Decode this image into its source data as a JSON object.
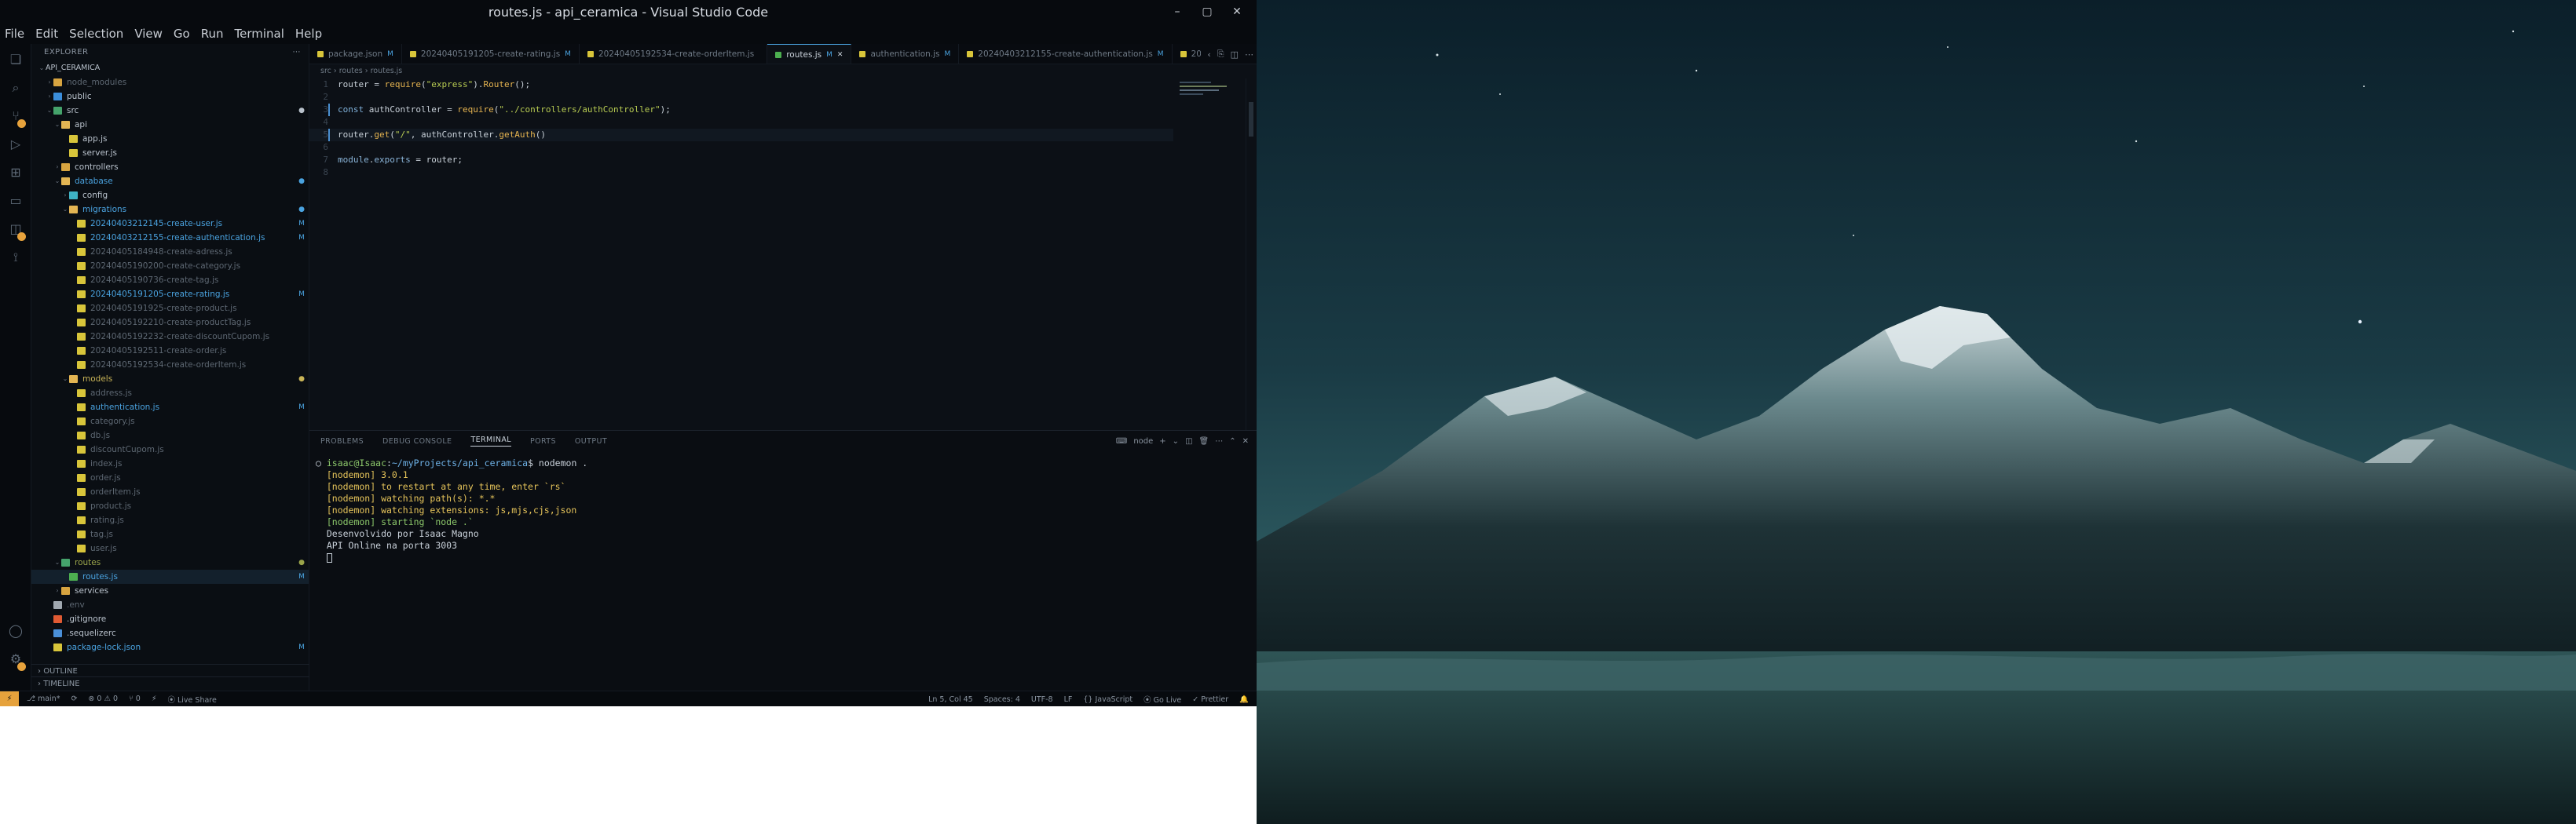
{
  "window": {
    "title": "routes.js - api_ceramica - Visual Studio Code",
    "controls": [
      "–",
      "▢",
      "✕"
    ]
  },
  "menu": [
    "File",
    "Edit",
    "Selection",
    "View",
    "Go",
    "Run",
    "Terminal",
    "Help"
  ],
  "explorer": {
    "header": "EXPLORER",
    "root": "API_CERAMICA",
    "tree": [
      {
        "label": "node_modules",
        "depth": 1,
        "icon": "folder",
        "color": "gray",
        "chev": "›",
        "stat": ""
      },
      {
        "label": "public",
        "depth": 1,
        "icon": "folder-blue",
        "color": "white",
        "chev": "›",
        "stat": ""
      },
      {
        "label": "src",
        "depth": 1,
        "icon": "folder-green",
        "color": "white",
        "chev": "⌄",
        "stat": "●"
      },
      {
        "label": "api",
        "depth": 2,
        "icon": "folder-open",
        "color": "white",
        "chev": "⌄",
        "stat": ""
      },
      {
        "label": "app.js",
        "depth": 3,
        "icon": "js",
        "color": "white",
        "chev": "",
        "stat": ""
      },
      {
        "label": "server.js",
        "depth": 3,
        "icon": "js",
        "color": "white",
        "chev": "",
        "stat": ""
      },
      {
        "label": "controllers",
        "depth": 2,
        "icon": "folder",
        "color": "white",
        "chev": "›",
        "stat": ""
      },
      {
        "label": "database",
        "depth": 2,
        "icon": "folder-open",
        "color": "mod",
        "chev": "⌄",
        "stat": "●"
      },
      {
        "label": "config",
        "depth": 3,
        "icon": "folder-cyan",
        "color": "white",
        "chev": "›",
        "stat": ""
      },
      {
        "label": "migrations",
        "depth": 3,
        "icon": "folder-open",
        "color": "mod",
        "chev": "⌄",
        "stat": "●"
      },
      {
        "label": "20240403212145-create-user.js",
        "depth": 4,
        "icon": "js",
        "color": "mod",
        "chev": "",
        "stat": "M"
      },
      {
        "label": "20240403212155-create-authentication.js",
        "depth": 4,
        "icon": "js",
        "color": "mod",
        "chev": "",
        "stat": "M"
      },
      {
        "label": "20240405184948-create-adress.js",
        "depth": 4,
        "icon": "js",
        "color": "gray",
        "chev": "",
        "stat": ""
      },
      {
        "label": "20240405190200-create-category.js",
        "depth": 4,
        "icon": "js",
        "color": "gray",
        "chev": "",
        "stat": ""
      },
      {
        "label": "20240405190736-create-tag.js",
        "depth": 4,
        "icon": "js",
        "color": "gray",
        "chev": "",
        "stat": ""
      },
      {
        "label": "20240405191205-create-rating.js",
        "depth": 4,
        "icon": "js",
        "color": "mod",
        "chev": "",
        "stat": "M"
      },
      {
        "label": "20240405191925-create-product.js",
        "depth": 4,
        "icon": "js",
        "color": "gray",
        "chev": "",
        "stat": ""
      },
      {
        "label": "20240405192210-create-productTag.js",
        "depth": 4,
        "icon": "js",
        "color": "gray",
        "chev": "",
        "stat": ""
      },
      {
        "label": "20240405192232-create-discountCupom.js",
        "depth": 4,
        "icon": "js",
        "color": "gray",
        "chev": "",
        "stat": ""
      },
      {
        "label": "20240405192511-create-order.js",
        "depth": 4,
        "icon": "js",
        "color": "gray",
        "chev": "",
        "stat": ""
      },
      {
        "label": "20240405192534-create-orderItem.js",
        "depth": 4,
        "icon": "js",
        "color": "gray",
        "chev": "",
        "stat": ""
      },
      {
        "label": "models",
        "depth": 3,
        "icon": "folder-open",
        "color": "yellow",
        "chev": "⌄",
        "stat": "●"
      },
      {
        "label": "address.js",
        "depth": 4,
        "icon": "js",
        "color": "gray",
        "chev": "",
        "stat": ""
      },
      {
        "label": "authentication.js",
        "depth": 4,
        "icon": "js",
        "color": "mod",
        "chev": "",
        "stat": "M"
      },
      {
        "label": "category.js",
        "depth": 4,
        "icon": "js",
        "color": "gray",
        "chev": "",
        "stat": ""
      },
      {
        "label": "db.js",
        "depth": 4,
        "icon": "js",
        "color": "gray",
        "chev": "",
        "stat": ""
      },
      {
        "label": "discountCupom.js",
        "depth": 4,
        "icon": "js",
        "color": "gray",
        "chev": "",
        "stat": ""
      },
      {
        "label": "index.js",
        "depth": 4,
        "icon": "js",
        "color": "gray",
        "chev": "",
        "stat": ""
      },
      {
        "label": "order.js",
        "depth": 4,
        "icon": "js",
        "color": "gray",
        "chev": "",
        "stat": ""
      },
      {
        "label": "orderItem.js",
        "depth": 4,
        "icon": "js",
        "color": "gray",
        "chev": "",
        "stat": ""
      },
      {
        "label": "product.js",
        "depth": 4,
        "icon": "js",
        "color": "gray",
        "chev": "",
        "stat": ""
      },
      {
        "label": "rating.js",
        "depth": 4,
        "icon": "js",
        "color": "gray",
        "chev": "",
        "stat": ""
      },
      {
        "label": "tag.js",
        "depth": 4,
        "icon": "js",
        "color": "gray",
        "chev": "",
        "stat": ""
      },
      {
        "label": "user.js",
        "depth": 4,
        "icon": "js",
        "color": "gray",
        "chev": "",
        "stat": ""
      },
      {
        "label": "routes",
        "depth": 2,
        "icon": "folder-green",
        "color": "olive",
        "chev": "⌄",
        "stat": "●"
      },
      {
        "label": "routes.js",
        "depth": 3,
        "icon": "route",
        "color": "mod",
        "chev": "",
        "stat": "M",
        "selected": true
      },
      {
        "label": "services",
        "depth": 2,
        "icon": "folder",
        "color": "white",
        "chev": "›",
        "stat": ""
      },
      {
        "label": ".env",
        "depth": 1,
        "icon": "env",
        "color": "gray",
        "chev": "",
        "stat": ""
      },
      {
        "label": ".gitignore",
        "depth": 1,
        "icon": "git",
        "color": "white",
        "chev": "",
        "stat": ""
      },
      {
        "label": ".sequelizerc",
        "depth": 1,
        "icon": "npm",
        "color": "white",
        "chev": "",
        "stat": ""
      },
      {
        "label": "package-lock.json",
        "depth": 1,
        "icon": "json",
        "color": "mod",
        "chev": "",
        "stat": "M"
      }
    ],
    "outline": "OUTLINE",
    "timeline": "TIMELINE"
  },
  "tabs": [
    {
      "label": "package.json",
      "mod": "M",
      "icon": "#d8c53a",
      "active": false
    },
    {
      "label": "20240405191205-create-rating.js",
      "mod": "M",
      "icon": "#d8c53a",
      "active": false
    },
    {
      "label": "20240405192534-create-orderItem.js",
      "mod": "",
      "icon": "#d8c53a",
      "active": false
    },
    {
      "label": "routes.js",
      "mod": "M",
      "icon": "#4caf50",
      "active": true
    },
    {
      "label": "authentication.js",
      "mod": "M",
      "icon": "#d8c53a",
      "active": false
    },
    {
      "label": "20240403212155-create-authentication.js",
      "mod": "M",
      "icon": "#d8c53a",
      "active": false
    },
    {
      "label": "20",
      "mod": "",
      "icon": "#d8c53a",
      "active": false
    }
  ],
  "breadcrumbs": "src › routes › routes.js",
  "editor": {
    "lines": [
      {
        "n": "1",
        "parts": [
          [
            "router",
            "var"
          ],
          [
            " = ",
            "var"
          ],
          [
            "require",
            "fn"
          ],
          [
            "(",
            "var"
          ],
          [
            "\"express\"",
            "str"
          ],
          [
            ").",
            "var"
          ],
          [
            "Router",
            "fn"
          ],
          [
            "();",
            "var"
          ]
        ]
      },
      {
        "n": "2",
        "parts": []
      },
      {
        "n": "3",
        "parts": [
          [
            "const",
            "kw"
          ],
          [
            " authController = ",
            "var"
          ],
          [
            "require",
            "fn"
          ],
          [
            "(",
            "var"
          ],
          [
            "\"../controllers/authController\"",
            "str"
          ],
          [
            ");",
            "var"
          ]
        ]
      },
      {
        "n": "4",
        "parts": []
      },
      {
        "n": "5",
        "parts": [
          [
            "router",
            "var"
          ],
          [
            ".",
            "var"
          ],
          [
            "get",
            "fn"
          ],
          [
            "(",
            "var"
          ],
          [
            "\"/\"",
            "str"
          ],
          [
            ", authController.",
            "var"
          ],
          [
            "getAuth",
            "fn"
          ],
          [
            "()",
            "var"
          ]
        ]
      },
      {
        "n": "6",
        "parts": []
      },
      {
        "n": "7",
        "parts": [
          [
            "module",
            "dot"
          ],
          [
            ".",
            "var"
          ],
          [
            "exports",
            "dot"
          ],
          [
            " = router;",
            "var"
          ]
        ]
      },
      {
        "n": "8",
        "parts": []
      }
    ]
  },
  "panel": {
    "tabs": [
      "PROBLEMS",
      "DEBUG CONSOLE",
      "TERMINAL",
      "PORTS",
      "OUTPUT"
    ],
    "active_tab": "TERMINAL",
    "shell_label": "node",
    "terminal": [
      {
        "text": "○ ",
        "cls": "t-white",
        "extra": [
          [
            "isaac@Isaac",
            "t-green"
          ],
          [
            ":",
            "t-white"
          ],
          [
            "~/myProjects/api_ceramica",
            "t-blue"
          ],
          [
            "$ nodemon .",
            "t-white"
          ]
        ]
      },
      {
        "text": "  [nodemon] 3.0.1",
        "cls": "t-yellow"
      },
      {
        "text": "  [nodemon] to restart at any time, enter `rs`",
        "cls": "t-yellow"
      },
      {
        "text": "  [nodemon] watching path(s): *.*",
        "cls": "t-yellow"
      },
      {
        "text": "  [nodemon] watching extensions: js,mjs,cjs,json",
        "cls": "t-yellow"
      },
      {
        "text": "  [nodemon] starting `node .`",
        "cls": "t-green"
      },
      {
        "text": "  Desenvolvido por Isaac Magno",
        "cls": "t-white"
      },
      {
        "text": "  API Online na porta 3003",
        "cls": "t-white"
      }
    ]
  },
  "status": {
    "left": [
      "⎇ main*",
      "⟳",
      "⊗ 0 ⚠ 0",
      "⑂ 0",
      "⚡",
      "⦿ Live Share"
    ],
    "right": [
      "Ln 5, Col 45",
      "Spaces: 4",
      "UTF-8",
      "LF",
      "{} JavaScript",
      "⦿ Go Live",
      "✓ Prettier",
      "🔔"
    ]
  },
  "colors": {
    "accent": "#4aa3e0",
    "modified": "#4aa3e0",
    "remote": "#e6a23c",
    "editor_bg": "#0c1016"
  }
}
